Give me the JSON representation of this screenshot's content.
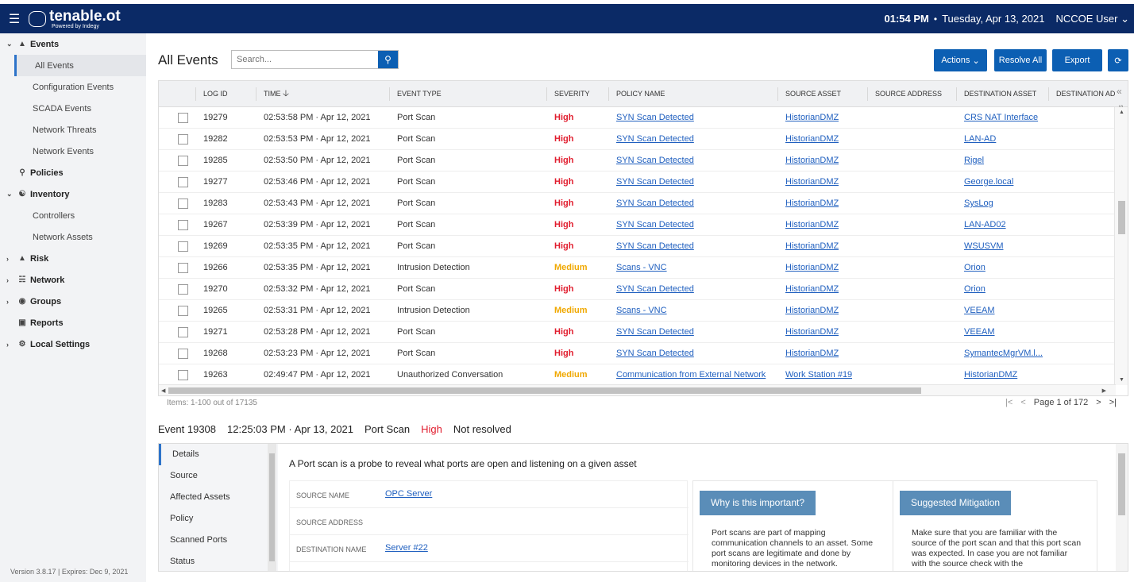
{
  "topbar": {
    "brand": "tenable.ot",
    "brand_sub": "Powered by Indegy",
    "time": "01:54 PM",
    "date": "Tuesday, Apr 13, 2021",
    "user": "NCCOE User"
  },
  "sidebar": {
    "events": "Events",
    "all_events": "All Events",
    "configuration_events": "Configuration Events",
    "scada_events": "SCADA Events",
    "network_threats": "Network Threats",
    "network_events": "Network Events",
    "policies": "Policies",
    "inventory": "Inventory",
    "controllers": "Controllers",
    "network_assets": "Network Assets",
    "risk": "Risk",
    "network": "Network",
    "groups": "Groups",
    "reports": "Reports",
    "local_settings": "Local Settings",
    "version": "Version 3.8.17 | Expires: Dec 9, 2021"
  },
  "header": {
    "title": "All Events",
    "search_placeholder": "Search...",
    "actions": "Actions",
    "resolve_all": "Resolve All",
    "export": "Export"
  },
  "grid": {
    "columns": {
      "log_id": "LOG ID",
      "time": "TIME",
      "event_type": "EVENT TYPE",
      "severity": "SEVERITY",
      "policy_name": "POLICY NAME",
      "source_asset": "SOURCE ASSET",
      "source_address": "SOURCE ADDRESS",
      "destination_asset": "DESTINATION ASSET",
      "destination_address": "DESTINATION AD..."
    },
    "settings_label": "settings",
    "rows": [
      {
        "id": "19279",
        "time": "02:53:58 PM · Apr 12, 2021",
        "type": "Port Scan",
        "severity": "High",
        "policy": "SYN Scan Detected",
        "source": "HistorianDMZ",
        "dest": "CRS NAT Interface"
      },
      {
        "id": "19282",
        "time": "02:53:53 PM · Apr 12, 2021",
        "type": "Port Scan",
        "severity": "High",
        "policy": "SYN Scan Detected",
        "source": "HistorianDMZ",
        "dest": "LAN-AD"
      },
      {
        "id": "19285",
        "time": "02:53:50 PM · Apr 12, 2021",
        "type": "Port Scan",
        "severity": "High",
        "policy": "SYN Scan Detected",
        "source": "HistorianDMZ",
        "dest": "Rigel"
      },
      {
        "id": "19277",
        "time": "02:53:46 PM · Apr 12, 2021",
        "type": "Port Scan",
        "severity": "High",
        "policy": "SYN Scan Detected",
        "source": "HistorianDMZ",
        "dest": "George.local"
      },
      {
        "id": "19283",
        "time": "02:53:43 PM · Apr 12, 2021",
        "type": "Port Scan",
        "severity": "High",
        "policy": "SYN Scan Detected",
        "source": "HistorianDMZ",
        "dest": "SysLog"
      },
      {
        "id": "19267",
        "time": "02:53:39 PM · Apr 12, 2021",
        "type": "Port Scan",
        "severity": "High",
        "policy": "SYN Scan Detected",
        "source": "HistorianDMZ",
        "dest": "LAN-AD02"
      },
      {
        "id": "19269",
        "time": "02:53:35 PM · Apr 12, 2021",
        "type": "Port Scan",
        "severity": "High",
        "policy": "SYN Scan Detected",
        "source": "HistorianDMZ",
        "dest": "WSUSVM"
      },
      {
        "id": "19266",
        "time": "02:53:35 PM · Apr 12, 2021",
        "type": "Intrusion Detection",
        "severity": "Medium",
        "policy": "Scans - VNC",
        "source": "HistorianDMZ",
        "dest": "Orion"
      },
      {
        "id": "19270",
        "time": "02:53:32 PM · Apr 12, 2021",
        "type": "Port Scan",
        "severity": "High",
        "policy": "SYN Scan Detected",
        "source": "HistorianDMZ",
        "dest": "Orion"
      },
      {
        "id": "19265",
        "time": "02:53:31 PM · Apr 12, 2021",
        "type": "Intrusion Detection",
        "severity": "Medium",
        "policy": "Scans - VNC",
        "source": "HistorianDMZ",
        "dest": "VEEAM"
      },
      {
        "id": "19271",
        "time": "02:53:28 PM · Apr 12, 2021",
        "type": "Port Scan",
        "severity": "High",
        "policy": "SYN Scan Detected",
        "source": "HistorianDMZ",
        "dest": "VEEAM"
      },
      {
        "id": "19268",
        "time": "02:53:23 PM · Apr 12, 2021",
        "type": "Port Scan",
        "severity": "High",
        "policy": "SYN Scan Detected",
        "source": "HistorianDMZ",
        "dest": "SymantecMgrVM.l..."
      },
      {
        "id": "19263",
        "time": "02:49:47 PM · Apr 12, 2021",
        "type": "Unauthorized Conversation",
        "severity": "Medium",
        "policy": "Communication from External Network",
        "source": "Work Station #19",
        "dest": "HistorianDMZ"
      }
    ]
  },
  "pager": {
    "items": "Items: 1-100 out of 17135",
    "page": "Page 1 of 172"
  },
  "detail": {
    "event_id": "Event 19308",
    "time": "12:25:03 PM · Apr 13, 2021",
    "type": "Port Scan",
    "severity": "High",
    "status": "Not resolved",
    "tabs": [
      "Details",
      "Source",
      "Affected Assets",
      "Policy",
      "Scanned Ports",
      "Status"
    ],
    "summary": "A Port scan is a probe to reveal what ports are open and listening on a given asset",
    "fields": {
      "source_name_label": "SOURCE NAME",
      "source_name": "OPC Server",
      "source_address_label": "SOURCE ADDRESS",
      "destination_name_label": "DESTINATION NAME",
      "destination_name": "Server #22"
    },
    "why_title": "Why is this important?",
    "why_text": "Port scans are part of mapping communication channels to an asset. Some port scans are legitimate and done by monitoring devices in the network.",
    "mitigation_title": "Suggested Mitigation",
    "mitigation_text": "Make sure that you are familiar with the source of the port scan and that this port scan was expected. In case you are not familiar with the source check with the"
  },
  "colors": {
    "topbar": "#0b2a66",
    "primary": "#0c5fb3",
    "high": "#e11d2e",
    "medium": "#f0a800",
    "link": "#1f5fbf",
    "card_header": "#5a8db8"
  }
}
